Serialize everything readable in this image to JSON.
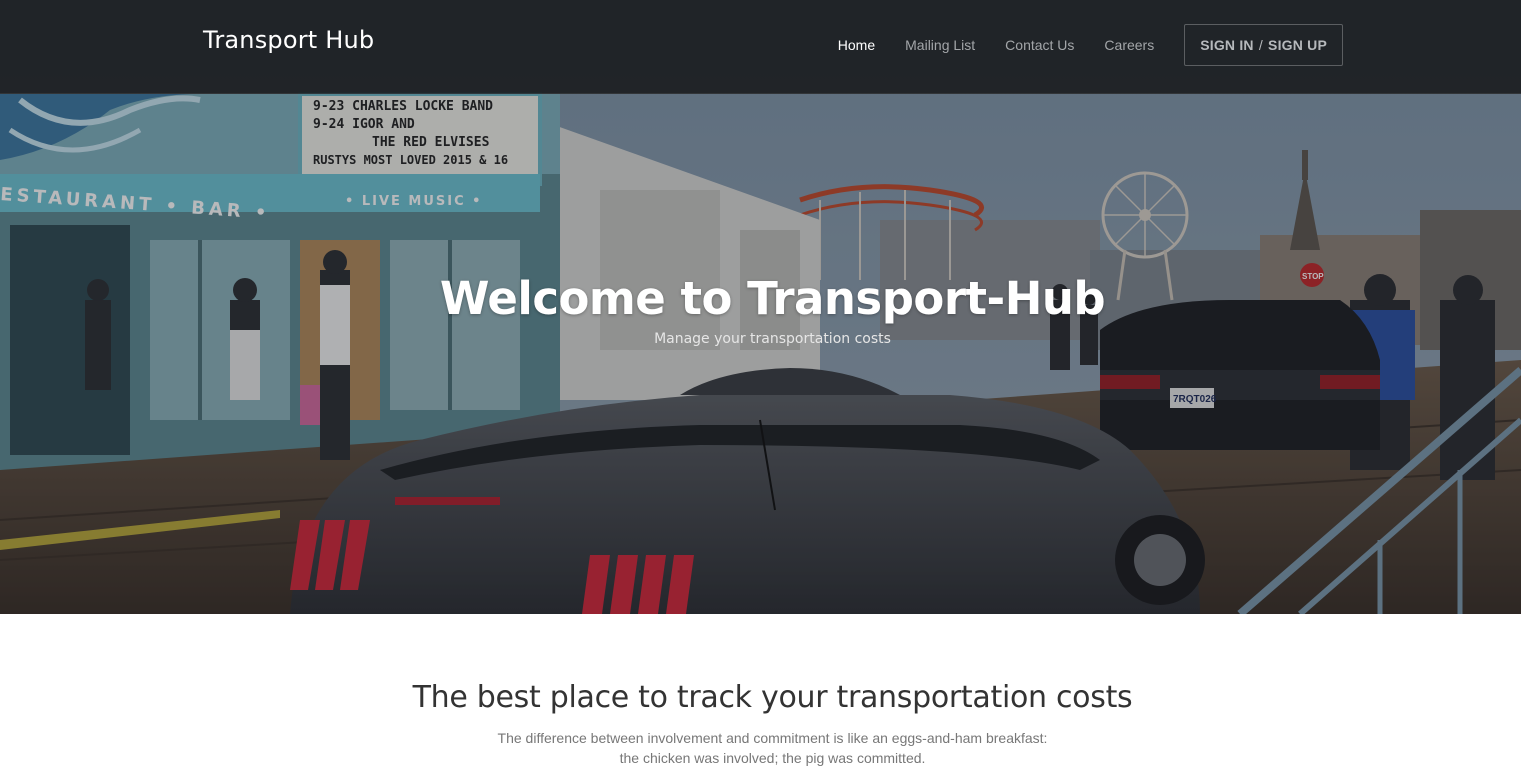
{
  "navbar": {
    "brand": "Transport Hub",
    "links": [
      {
        "label": "Home",
        "active": true
      },
      {
        "label": "Mailing List",
        "active": false
      },
      {
        "label": "Contact Us",
        "active": false
      },
      {
        "label": "Careers",
        "active": false
      }
    ],
    "sign_in": "SIGN IN",
    "separator": "/",
    "sign_up": "SIGN UP"
  },
  "hero": {
    "title": "Welcome to Transport-Hub",
    "subtitle": "Manage your transportation costs",
    "photo_signs": {
      "marquee_line1": "9-23 CHARLES LOCKE BAND",
      "marquee_line2": "9-24 IGOR AND",
      "marquee_line3": "THE RED ELVISES",
      "marquee_line4": "RUSTYS MOST LOVED 2015 & 16",
      "restaurant_sign": "ESTAURANT • BAR •",
      "live_music": "• LIVE MUSIC •",
      "stop_sign": "STOP",
      "plate": "7RQT026"
    }
  },
  "content": {
    "heading": "The best place to track your transportation costs",
    "quote_line1": "The difference between involvement and commitment is like an eggs-and-ham breakfast:",
    "quote_line2": "the chicken was involved; the pig was committed."
  },
  "colors": {
    "navbar_bg": "#181a1c",
    "nav_text": "#a3a6a9",
    "nav_active": "#ffffff",
    "heading_text": "#333333",
    "quote_text": "#777777"
  }
}
